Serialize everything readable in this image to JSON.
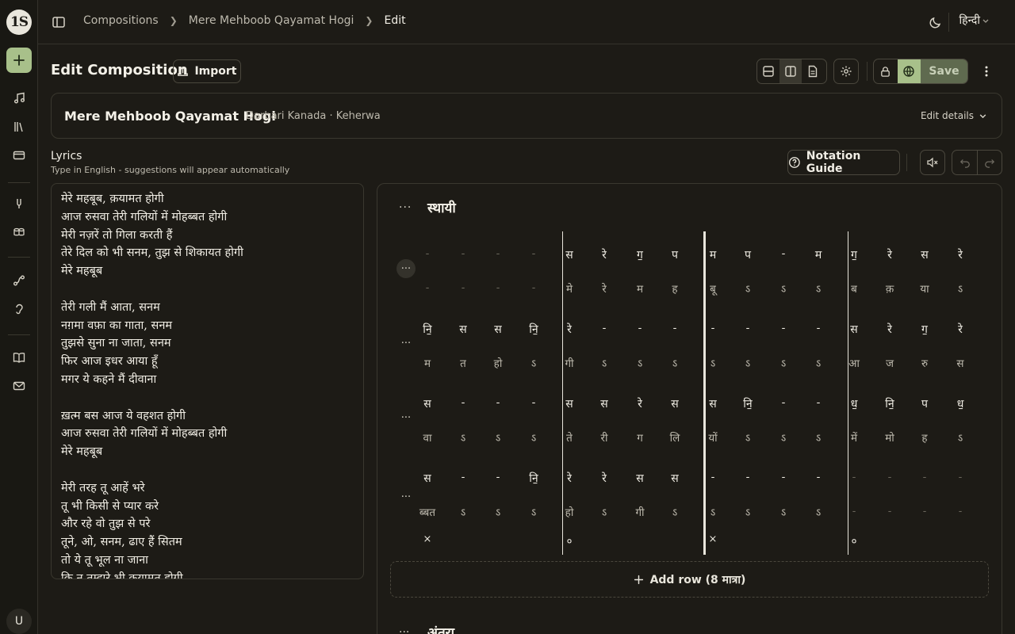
{
  "sidebar": {
    "logo": "1S",
    "user_initial": "U"
  },
  "breadcrumb": {
    "items": [
      "Compositions",
      "Mere Mehboob Qayamat Hogi",
      "Edit"
    ]
  },
  "topbar": {
    "language": "हिन्दी"
  },
  "header": {
    "title": "Edit Composition",
    "import_label": "Import",
    "save_label": "Save"
  },
  "details": {
    "title": "Mere Mehboob Qayamat Hogi",
    "meta": "Darbari Kanada · Keherwa",
    "edit_label": "Edit details"
  },
  "lyrics": {
    "label": "Lyrics",
    "hint": "Type in English - suggestions will appear automatically",
    "lines": [
      "मेरे महबूब, क़यामत होगी",
      "आज रुसवा तेरी गलियों में मोहब्बत होगी",
      "मेरी नज़रें तो गिला करती हैं",
      "तेरे दिल को भी सनम, तुझ से शिकायत होगी",
      "मेरे महबूब",
      "",
      "तेरी गली मैं आता, सनम",
      "नग़मा वफ़ा का गाता, सनम",
      "तुझसे सुना ना जाता, सनम",
      "फिर आज इधर आया हूँ",
      "मगर ये कहने मैं दीवाना",
      "",
      "ख़त्म बस आज ये वहशत होगी",
      "आज रुसवा तेरी गलियों में मोहब्बत होगी",
      "मेरे महबूब",
      "",
      "मेरी तरह तू आहें भरे",
      "तू भी किसी से प्यार करे",
      "और रहे वो तुझ से परे",
      "तूने, ओ, सनम, ढाए हैं सितम",
      "तो ये तू भूल ना जाना",
      "कि न तुम्हारे भी क़यामत होगी"
    ]
  },
  "controls": {
    "notation_guide_label": "Notation Guide"
  },
  "notation": {
    "section_title": "स्थायी",
    "next_section_title": "अंतरा",
    "add_row_label": "Add row (8 मात्रा)",
    "rows": [
      {
        "swaras": [
          "-",
          "-",
          "-",
          "-",
          "स",
          "रे",
          "ग॒",
          "प",
          "म",
          "प",
          "-",
          "म",
          "ग॒",
          "रे",
          "स",
          "रे"
        ],
        "lyrics": [
          "-",
          "-",
          "-",
          "-",
          "मे",
          "रे",
          "म",
          "ह",
          "बू",
          "ऽ",
          "ऽ",
          "ऽ",
          "ब",
          "क़",
          "या",
          "ऽ"
        ],
        "swara_dim": [
          1,
          1,
          1,
          1,
          0,
          0,
          0,
          0,
          0,
          0,
          0,
          0,
          0,
          0,
          0,
          0
        ],
        "lyric_dim": [
          1,
          1,
          1,
          1,
          0,
          0,
          0,
          0,
          0,
          0,
          0,
          0,
          0,
          0,
          0,
          0
        ]
      },
      {
        "swaras": [
          "नि॒",
          "स",
          "स",
          "नि॒",
          "रे",
          "-",
          "-",
          "-",
          "-",
          "-",
          "-",
          "-",
          "स",
          "रे",
          "ग॒",
          "रे"
        ],
        "lyrics": [
          "म",
          "त",
          "हो",
          "ऽ",
          "गी",
          "ऽ",
          "ऽ",
          "ऽ",
          "ऽ",
          "ऽ",
          "ऽ",
          "ऽ",
          "आ",
          "ज",
          "रु",
          "स"
        ],
        "swara_dim": [
          0,
          0,
          0,
          0,
          0,
          0,
          0,
          0,
          0,
          0,
          0,
          0,
          0,
          0,
          0,
          0
        ],
        "lyric_dim": [
          0,
          0,
          0,
          0,
          0,
          0,
          0,
          0,
          0,
          0,
          0,
          0,
          0,
          0,
          0,
          0
        ]
      },
      {
        "swaras": [
          "स",
          "-",
          "-",
          "-",
          "स",
          "स",
          "रे",
          "स",
          "स",
          "नि॒",
          "-",
          "-",
          "ध॒",
          "नि॒",
          "प",
          "ध॒"
        ],
        "lyrics": [
          "वा",
          "ऽ",
          "ऽ",
          "ऽ",
          "ते",
          "री",
          "ग",
          "लि",
          "यों",
          "ऽ",
          "ऽ",
          "ऽ",
          "में",
          "मो",
          "ह",
          "ऽ"
        ],
        "swara_dim": [
          0,
          0,
          0,
          0,
          0,
          0,
          0,
          0,
          0,
          0,
          0,
          0,
          0,
          0,
          0,
          0
        ],
        "lyric_dim": [
          0,
          0,
          0,
          0,
          0,
          0,
          0,
          0,
          0,
          0,
          0,
          0,
          0,
          0,
          0,
          0
        ]
      },
      {
        "swaras": [
          "स",
          "-",
          "-",
          "नि॒",
          "रे",
          "रे",
          "स",
          "स",
          "-",
          "-",
          "-",
          "-",
          "-",
          "-",
          "-",
          "-"
        ],
        "lyrics": [
          "ब्बत",
          "ऽ",
          "ऽ",
          "ऽ",
          "हो",
          "ऽ",
          "गी",
          "ऽ",
          "ऽ",
          "ऽ",
          "ऽ",
          "ऽ",
          "-",
          "-",
          "-",
          "-"
        ],
        "swara_dim": [
          0,
          0,
          0,
          0,
          0,
          0,
          0,
          0,
          0,
          0,
          0,
          0,
          1,
          1,
          1,
          1
        ],
        "lyric_dim": [
          0,
          0,
          0,
          0,
          0,
          0,
          0,
          0,
          0,
          0,
          0,
          0,
          1,
          1,
          1,
          1
        ]
      }
    ],
    "taal_marks": [
      "×",
      "०",
      "×",
      "०"
    ]
  }
}
